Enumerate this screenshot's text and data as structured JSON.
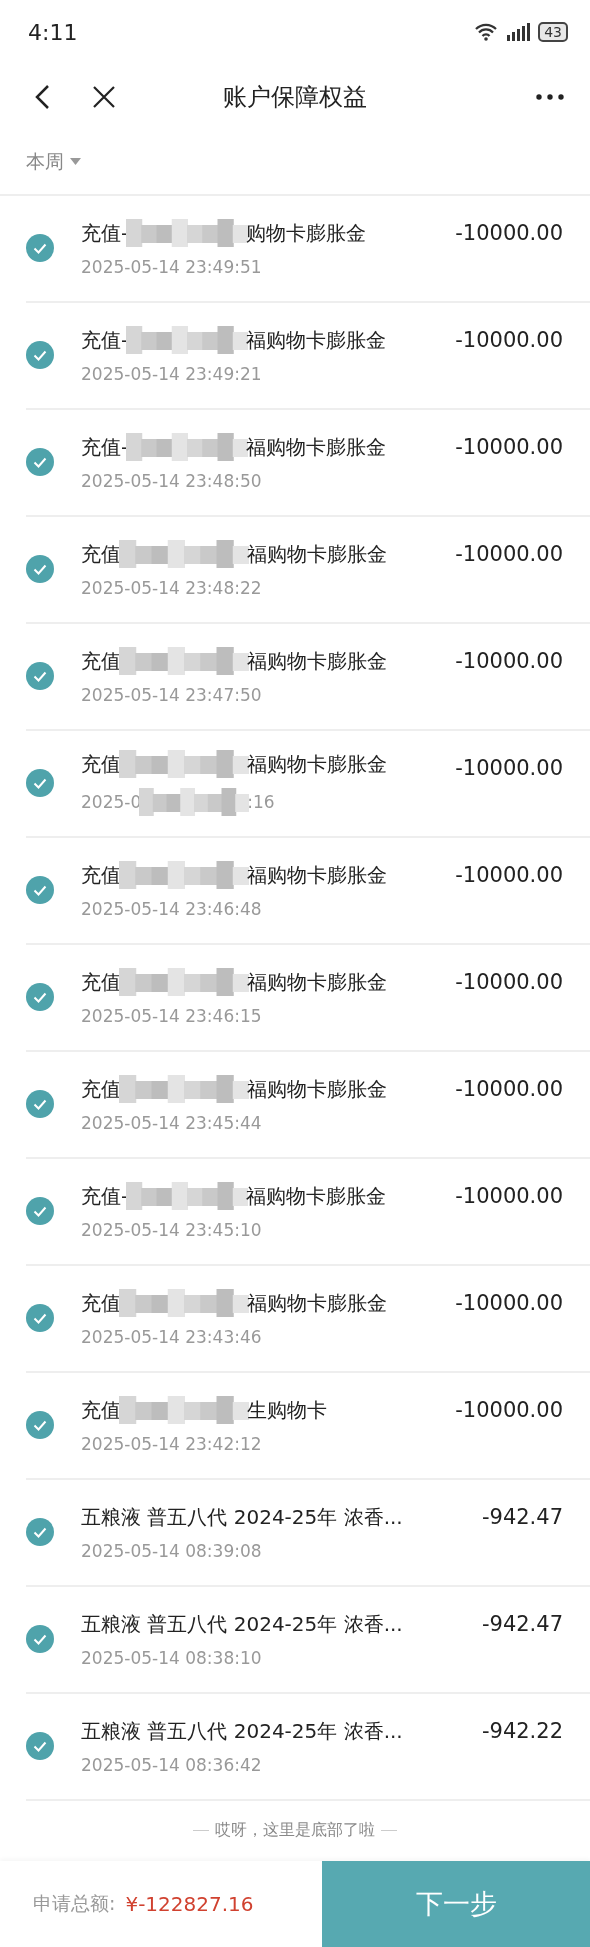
{
  "status_bar": {
    "time": "4:11",
    "battery": "43"
  },
  "nav": {
    "title": "账户保障权益"
  },
  "filter": {
    "label": "本周"
  },
  "rows": [
    {
      "title_start": "充值-",
      "redacted": true,
      "title_end": "购物卡膨胀金",
      "time": "2025-05-14 23:49:51",
      "amount": "-10000.00",
      "checked": true
    },
    {
      "title_start": "充值-",
      "redacted": true,
      "title_end": "福购物卡膨胀金",
      "time": "2025-05-14 23:49:21",
      "amount": "-10000.00",
      "checked": true
    },
    {
      "title_start": "充值-",
      "redacted": true,
      "title_end": "福购物卡膨胀金",
      "time": "2025-05-14 23:48:50",
      "amount": "-10000.00",
      "checked": true
    },
    {
      "title_start": "充值",
      "redacted": true,
      "title_end": "福购物卡膨胀金",
      "time": "2025-05-14 23:48:22",
      "amount": "-10000.00",
      "checked": true
    },
    {
      "title_start": "充值",
      "redacted": true,
      "title_end": "福购物卡膨胀金",
      "time": "2025-05-14 23:47:50",
      "amount": "-10000.00",
      "checked": true
    },
    {
      "title_start": "充值",
      "redacted": true,
      "title_end": "福购物卡膨胀金",
      "time": "2025-0",
      "time_end": ":16",
      "amount": "-10000.00",
      "checked": true
    },
    {
      "title_start": "充值",
      "redacted": true,
      "title_end": "福购物卡膨胀金",
      "time": "2025-05-14 23:46:48",
      "amount": "-10000.00",
      "checked": true
    },
    {
      "title_start": "充值",
      "redacted": true,
      "title_end": "福购物卡膨胀金",
      "time": "2025-05-14 23:46:15",
      "amount": "-10000.00",
      "checked": true
    },
    {
      "title_start": "充值",
      "redacted": true,
      "title_end": "福购物卡膨胀金",
      "time": "2025-05-14 23:45:44",
      "amount": "-10000.00",
      "checked": true
    },
    {
      "title_start": "充值-",
      "redacted": true,
      "title_end": "福购物卡膨胀金",
      "time": "2025-05-14 23:45:10",
      "amount": "-10000.00",
      "checked": true
    },
    {
      "title_start": "充值",
      "redacted": true,
      "title_end": "福购物卡膨胀金",
      "time": "2025-05-14 23:43:46",
      "amount": "-10000.00",
      "checked": true
    },
    {
      "title_start": "充值",
      "redacted": true,
      "title_end": "生购物卡",
      "time": "2025-05-14 23:42:12",
      "amount": "-10000.00",
      "checked": true
    },
    {
      "title_start": "五粮液 普五八代 2024-25年 浓香...",
      "redacted": false,
      "time": "2025-05-14 08:39:08",
      "amount": "-942.47",
      "checked": true
    },
    {
      "title_start": "五粮液 普五八代 2024-25年 浓香...",
      "redacted": false,
      "time": "2025-05-14 08:38:10",
      "amount": "-942.47",
      "checked": true
    },
    {
      "title_start": "五粮液 普五八代 2024-25年 浓香...",
      "redacted": false,
      "time": "2025-05-14 08:36:42",
      "amount": "-942.22",
      "checked": true
    }
  ],
  "end_note": "哎呀，这里是底部了啦",
  "footer": {
    "total_label": "申请总额:",
    "total": "¥-122827.16",
    "button": "下一步"
  }
}
